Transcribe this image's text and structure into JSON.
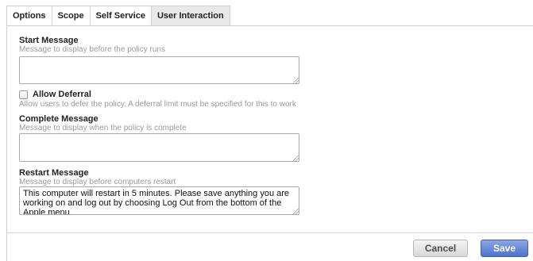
{
  "tabs": [
    {
      "label": "Options"
    },
    {
      "label": "Scope"
    },
    {
      "label": "Self Service"
    },
    {
      "label": "User Interaction",
      "active": true
    }
  ],
  "start_message": {
    "label": "Start Message",
    "description": "Message to display before the policy runs",
    "value": ""
  },
  "allow_deferral": {
    "label": "Allow Deferral",
    "checked": false,
    "description": "Allow users to defer the policy. A deferral limit must be specified for this to work"
  },
  "complete_message": {
    "label": "Complete Message",
    "description": "Message to display when the policy is complete",
    "value": ""
  },
  "restart_message": {
    "label": "Restart Message",
    "description": "Message to display before computers restart",
    "value": "This computer will restart in 5 minutes. Please save anything you are working on and log out by choosing Log Out from the bottom of the Apple menu."
  },
  "footer": {
    "cancel_label": "Cancel",
    "save_label": "Save"
  },
  "colors": {
    "active_tab_bg": "#e9e9e9",
    "save_button": "#5b7fd6",
    "border": "#cfcfcf"
  }
}
